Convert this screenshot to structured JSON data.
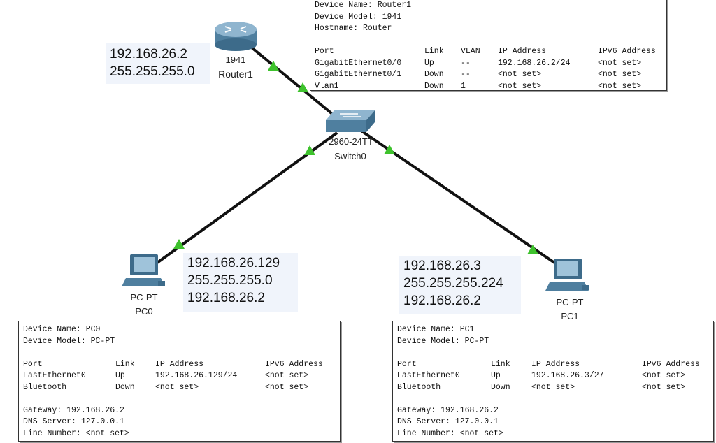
{
  "colors": {
    "link": "#111111",
    "link_light": "#3ec22d",
    "note_bg": "#f0f4fb"
  },
  "devices": {
    "router": {
      "model": "1941",
      "name": "Router1",
      "icon": "router-icon"
    },
    "switch": {
      "model": "2960-24TT",
      "name": "Switch0",
      "icon": "switch-icon"
    },
    "pc0": {
      "model": "PC-PT",
      "name": "PC0",
      "icon": "pc-icon"
    },
    "pc1": {
      "model": "PC-PT",
      "name": "PC1",
      "icon": "pc-icon"
    }
  },
  "notes": {
    "router": {
      "ip": "192.168.26.2",
      "mask": "255.255.255.0"
    },
    "pc0": {
      "ip": "192.168.26.129",
      "mask": "255.255.255.0",
      "gateway": "192.168.26.2"
    },
    "pc1": {
      "ip": "192.168.26.3",
      "mask": "255.255.255.224",
      "gateway": "192.168.26.2"
    }
  },
  "popups": {
    "router": {
      "device_name": "Device Name: Router1",
      "device_model": "Device Model: 1941",
      "hostname": "Hostname: Router",
      "headers": {
        "port": "Port",
        "link": "Link",
        "vlan": "VLAN",
        "ip": "IP Address",
        "ipv6": "IPv6 Address"
      },
      "rows": [
        {
          "port": "GigabitEthernet0/0",
          "link": "Up",
          "vlan": "--",
          "ip": "192.168.26.2/24",
          "ipv6": "<not set>"
        },
        {
          "port": "GigabitEthernet0/1",
          "link": "Down",
          "vlan": "--",
          "ip": "<not set>",
          "ipv6": "<not set>"
        },
        {
          "port": "Vlan1",
          "link": "Down",
          "vlan": "1",
          "ip": "<not set>",
          "ipv6": "<not set>"
        }
      ]
    },
    "pc0": {
      "device_name": "Device Name: PC0",
      "device_model": "Device Model: PC-PT",
      "headers": {
        "port": "Port",
        "link": "Link",
        "ip": "IP Address",
        "ipv6": "IPv6 Address"
      },
      "rows": [
        {
          "port": "FastEthernet0",
          "link": "Up",
          "ip": "192.168.26.129/24",
          "ipv6": "<not set>"
        },
        {
          "port": "Bluetooth",
          "link": "Down",
          "ip": "<not set>",
          "ipv6": "<not set>"
        }
      ],
      "gateway": "Gateway: 192.168.26.2",
      "dns": "DNS Server: 127.0.0.1",
      "line": "Line Number:  <not set>"
    },
    "pc1": {
      "device_name": "Device Name: PC1",
      "device_model": "Device Model: PC-PT",
      "headers": {
        "port": "Port",
        "link": "Link",
        "ip": "IP Address",
        "ipv6": "IPv6 Address"
      },
      "rows": [
        {
          "port": "FastEthernet0",
          "link": "Up",
          "ip": "192.168.26.3/27",
          "ipv6": "<not set>"
        },
        {
          "port": "Bluetooth",
          "link": "Down",
          "ip": "<not set>",
          "ipv6": "<not set>"
        }
      ],
      "gateway": "Gateway: 192.168.26.2",
      "dns": "DNS Server: 127.0.0.1",
      "line": "Line Number:  <not set>"
    }
  }
}
